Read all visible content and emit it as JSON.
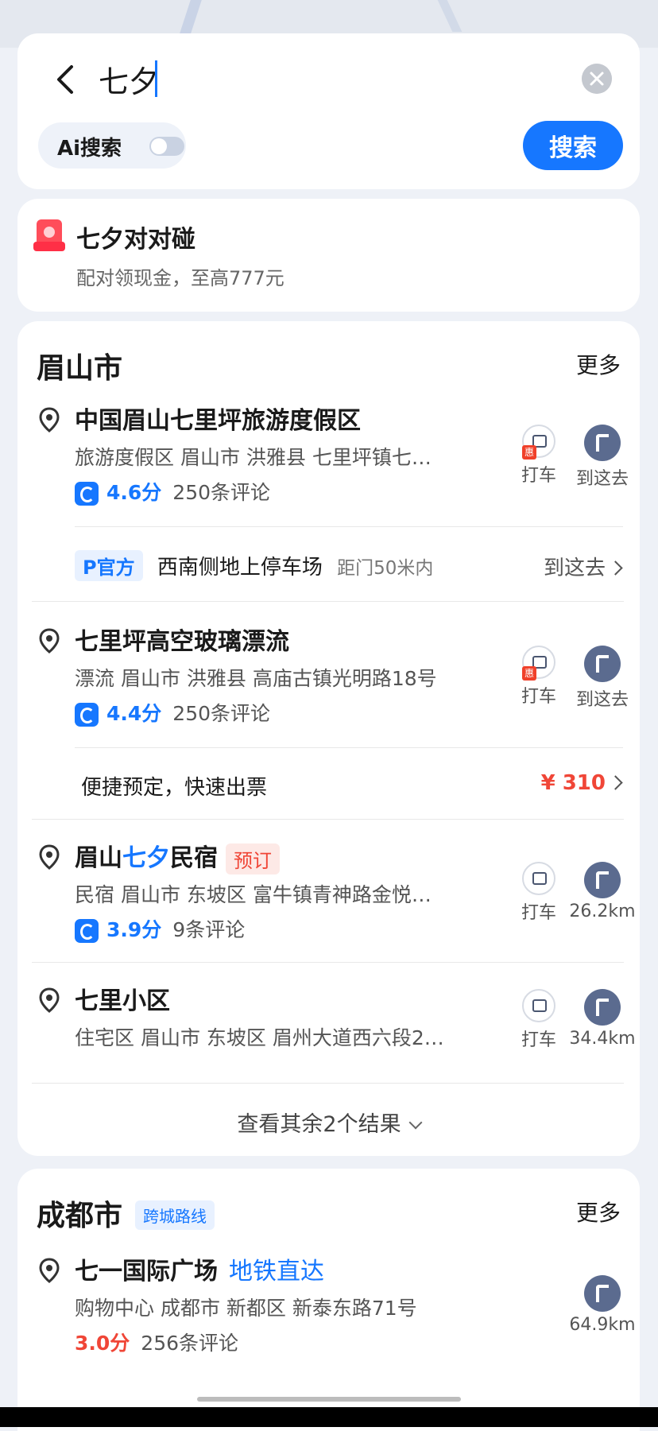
{
  "search": {
    "query": "七夕",
    "ai_label": "Ai搜索",
    "ai_enabled": false,
    "button_label": "搜索"
  },
  "promo": {
    "title": "七夕对对碰",
    "subtitle": "配对领现金，至高777元"
  },
  "meishan": {
    "city": "眉山市",
    "more": "更多",
    "pois": [
      {
        "name": "中国眉山七里坪旅游度假区",
        "meta": "旅游度假区  眉山市 洪雅县 七里坪镇七…",
        "rating": "4.6分",
        "reviews": "250条评论",
        "taxi_label": "打车",
        "go_label": "到这去",
        "parking": {
          "tag": "P官方",
          "name": "西南侧地上停车场",
          "distance": "距门50米内",
          "action": "到这去"
        }
      },
      {
        "name": "七里坪高空玻璃漂流",
        "meta": "漂流  眉山市 洪雅县 高庙古镇光明路18号",
        "rating": "4.4分",
        "reviews": "250条评论",
        "taxi_label": "打车",
        "go_label": "到这去",
        "ticket": {
          "text": "便捷预定，快速出票",
          "price": "¥ 310"
        }
      },
      {
        "name_prefix": "眉山",
        "name_highlight": "七夕",
        "name_suffix": "民宿",
        "tag": "预订",
        "meta": "民宿  眉山市 东坡区 富牛镇青神路金悦…",
        "rating": "3.9分",
        "reviews": "9条评论",
        "taxi_label": "打车",
        "distance": "26.2km"
      },
      {
        "name": "七里小区",
        "meta": "住宅区  眉山市 东坡区 眉州大道西六段2…",
        "taxi_label": "打车",
        "distance": "34.4km"
      }
    ],
    "more_results": "查看其余2个结果"
  },
  "chengdu": {
    "city": "成都市",
    "tag": "跨城路线",
    "more": "更多",
    "poi": {
      "name": "七一国际广场",
      "tag": "地铁直达",
      "meta": "购物中心  成都市 新都区 新泰东路71号",
      "rating": "3.0分",
      "reviews": "256条评论",
      "distance": "64.9km"
    }
  },
  "colors": {
    "accent": "#1677ff",
    "price_red": "#f04637",
    "background": "#eef1f7"
  }
}
